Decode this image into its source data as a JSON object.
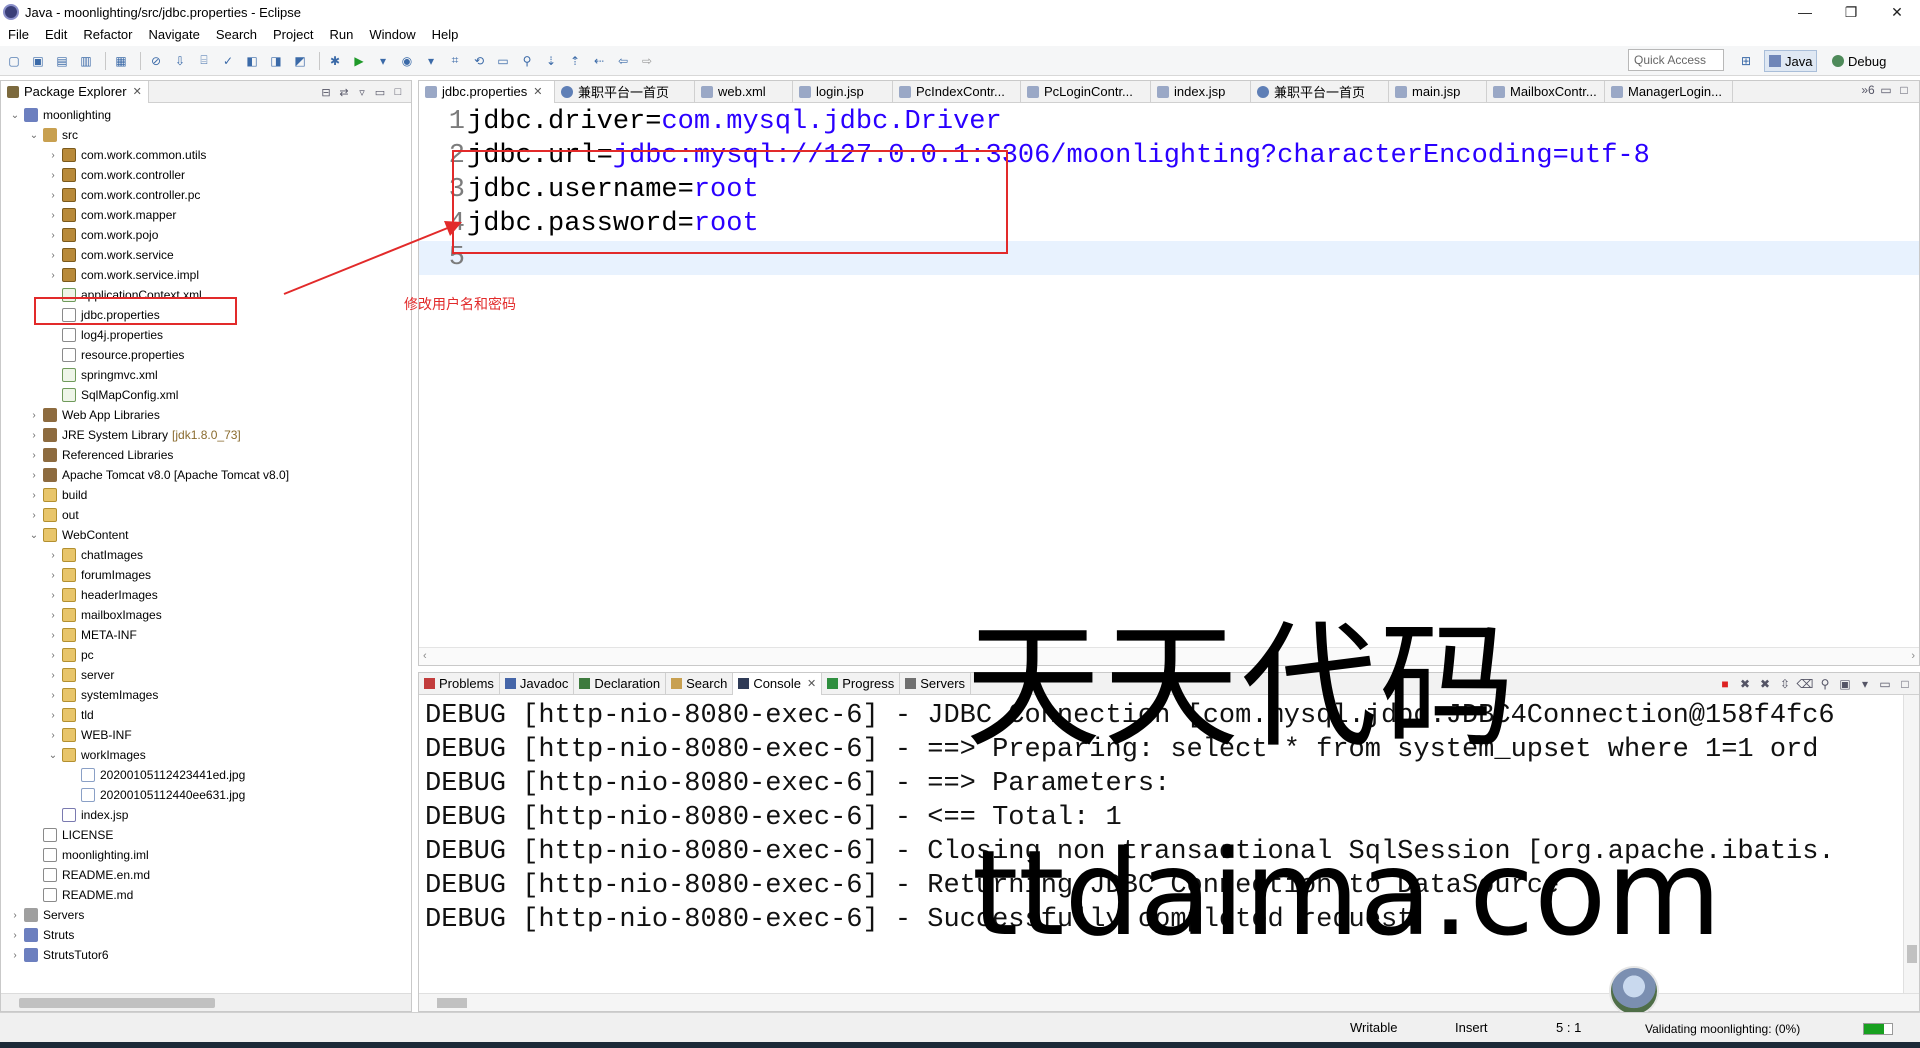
{
  "window": {
    "title": "Java - moonlighting/src/jdbc.properties - Eclipse",
    "controls": [
      "—",
      "❐",
      "✕"
    ]
  },
  "menu": [
    "File",
    "Edit",
    "Refactor",
    "Navigate",
    "Search",
    "Project",
    "Run",
    "Window",
    "Help"
  ],
  "toolbar": {
    "quick_access_placeholder": "Quick Access",
    "perspectives": [
      "Java",
      "Debug"
    ]
  },
  "package_explorer": {
    "tab_label": "Package Explorer",
    "tree": [
      {
        "label": "moonlighting",
        "level": 0,
        "twisty": "open",
        "icon": "project-icon"
      },
      {
        "label": "src",
        "level": 1,
        "twisty": "open",
        "icon": "source-folder-icon"
      },
      {
        "label": "com.work.common.utils",
        "level": 2,
        "twisty": "closed",
        "icon": "package-icon"
      },
      {
        "label": "com.work.controller",
        "level": 2,
        "twisty": "closed",
        "icon": "package-icon"
      },
      {
        "label": "com.work.controller.pc",
        "level": 2,
        "twisty": "closed",
        "icon": "package-icon"
      },
      {
        "label": "com.work.mapper",
        "level": 2,
        "twisty": "closed",
        "icon": "package-icon"
      },
      {
        "label": "com.work.pojo",
        "level": 2,
        "twisty": "closed",
        "icon": "package-icon"
      },
      {
        "label": "com.work.service",
        "level": 2,
        "twisty": "closed",
        "icon": "package-icon"
      },
      {
        "label": "com.work.service.impl",
        "level": 2,
        "twisty": "closed",
        "icon": "package-icon"
      },
      {
        "label": "applicationContext.xml",
        "level": 2,
        "twisty": "",
        "icon": "xml-file-icon"
      },
      {
        "label": "jdbc.properties",
        "level": 2,
        "twisty": "",
        "icon": "properties-file-icon"
      },
      {
        "label": "log4j.properties",
        "level": 2,
        "twisty": "",
        "icon": "properties-file-icon"
      },
      {
        "label": "resource.properties",
        "level": 2,
        "twisty": "",
        "icon": "properties-file-icon"
      },
      {
        "label": "springmvc.xml",
        "level": 2,
        "twisty": "",
        "icon": "xml-file-icon"
      },
      {
        "label": "SqlMapConfig.xml",
        "level": 2,
        "twisty": "",
        "icon": "xml-file-icon"
      },
      {
        "label": "Web App Libraries",
        "level": 1,
        "twisty": "closed",
        "icon": "library-icon"
      },
      {
        "label": "JRE System Library",
        "level": 1,
        "twisty": "closed",
        "icon": "library-icon",
        "suffix": "[jdk1.8.0_73]"
      },
      {
        "label": "Referenced Libraries",
        "level": 1,
        "twisty": "closed",
        "icon": "library-icon"
      },
      {
        "label": "Apache Tomcat v8.0 [Apache Tomcat v8.0]",
        "level": 1,
        "twisty": "closed",
        "icon": "library-icon"
      },
      {
        "label": "build",
        "level": 1,
        "twisty": "closed",
        "icon": "folder-icon"
      },
      {
        "label": "out",
        "level": 1,
        "twisty": "closed",
        "icon": "folder-icon"
      },
      {
        "label": "WebContent",
        "level": 1,
        "twisty": "open",
        "icon": "folder-icon"
      },
      {
        "label": "chatImages",
        "level": 2,
        "twisty": "closed",
        "icon": "folder-icon"
      },
      {
        "label": "forumImages",
        "level": 2,
        "twisty": "closed",
        "icon": "folder-icon"
      },
      {
        "label": "headerImages",
        "level": 2,
        "twisty": "closed",
        "icon": "folder-icon"
      },
      {
        "label": "mailboxImages",
        "level": 2,
        "twisty": "closed",
        "icon": "folder-icon"
      },
      {
        "label": "META-INF",
        "level": 2,
        "twisty": "closed",
        "icon": "folder-icon"
      },
      {
        "label": "pc",
        "level": 2,
        "twisty": "closed",
        "icon": "folder-icon"
      },
      {
        "label": "server",
        "level": 2,
        "twisty": "closed",
        "icon": "folder-icon"
      },
      {
        "label": "systemImages",
        "level": 2,
        "twisty": "closed",
        "icon": "folder-icon"
      },
      {
        "label": "tld",
        "level": 2,
        "twisty": "closed",
        "icon": "folder-icon"
      },
      {
        "label": "WEB-INF",
        "level": 2,
        "twisty": "closed",
        "icon": "folder-icon"
      },
      {
        "label": "workImages",
        "level": 2,
        "twisty": "open",
        "icon": "folder-icon"
      },
      {
        "label": "20200105112423441ed.jpg",
        "level": 3,
        "twisty": "",
        "icon": "image-file-icon"
      },
      {
        "label": "20200105112440ee631.jpg",
        "level": 3,
        "twisty": "",
        "icon": "image-file-icon"
      },
      {
        "label": "index.jsp",
        "level": 2,
        "twisty": "",
        "icon": "jsp-file-icon"
      },
      {
        "label": "LICENSE",
        "level": 1,
        "twisty": "",
        "icon": "file-icon"
      },
      {
        "label": "moonlighting.iml",
        "level": 1,
        "twisty": "",
        "icon": "file-icon"
      },
      {
        "label": "README.en.md",
        "level": 1,
        "twisty": "",
        "icon": "file-icon"
      },
      {
        "label": "README.md",
        "level": 1,
        "twisty": "",
        "icon": "file-icon"
      },
      {
        "label": "Servers",
        "level": 0,
        "twisty": "closed",
        "icon": "server-project-icon"
      },
      {
        "label": "Struts",
        "level": 0,
        "twisty": "closed",
        "icon": "project-icon"
      },
      {
        "label": "StrutsTutor6",
        "level": 0,
        "twisty": "closed",
        "icon": "project-icon"
      }
    ]
  },
  "editor": {
    "tabs": [
      {
        "label": "jdbc.properties",
        "active": true
      },
      {
        "label": "兼职平台一首页",
        "globe": true
      },
      {
        "label": "web.xml"
      },
      {
        "label": "login.jsp"
      },
      {
        "label": "PcIndexContr..."
      },
      {
        "label": "PcLoginContr..."
      },
      {
        "label": "index.jsp"
      },
      {
        "label": "兼职平台一首页",
        "globe": true
      },
      {
        "label": "main.jsp"
      },
      {
        "label": "MailboxContr..."
      },
      {
        "label": "ManagerLogin..."
      }
    ],
    "overflow_count": "»6",
    "lines": [
      {
        "no": "1",
        "key": "jdbc.driver=",
        "value": "com.mysql.jdbc.Driver"
      },
      {
        "no": "2",
        "key": "jdbc.url=",
        "value": "jdbc:mysql://127.0.0.1:3306/moonlighting?characterEncoding=utf-8"
      },
      {
        "no": "3",
        "key": "jdbc.username=",
        "value": "root"
      },
      {
        "no": "4",
        "key": "jdbc.password=",
        "value": "root"
      },
      {
        "no": "5",
        "key": "",
        "value": "",
        "current": true
      }
    ]
  },
  "annotation": {
    "text": "修改用户名和密码",
    "color": "#e22a2a"
  },
  "console": {
    "tabs": [
      {
        "label": "Problems",
        "icon": "problems-icon"
      },
      {
        "label": "Javadoc",
        "icon": "javadoc-icon"
      },
      {
        "label": "Declaration",
        "icon": "declaration-icon"
      },
      {
        "label": "Search",
        "icon": "search-icon"
      },
      {
        "label": "Console",
        "icon": "console-icon",
        "active": true
      },
      {
        "label": "Progress",
        "icon": "progress-icon"
      },
      {
        "label": "Servers",
        "icon": "servers-icon"
      }
    ],
    "lines": [
      "DEBUG [http-nio-8080-exec-6] - JDBC Connection [com.mysql.jdbc.JDBC4Connection@158f4fc6",
      "DEBUG [http-nio-8080-exec-6] - ==>  Preparing: select * from system_upset where 1=1 ord",
      "DEBUG [http-nio-8080-exec-6] - ==> Parameters: ",
      "DEBUG [http-nio-8080-exec-6] - <==      Total: 1",
      "DEBUG [http-nio-8080-exec-6] - Closing non transactional SqlSession [org.apache.ibatis.",
      "DEBUG [http-nio-8080-exec-6] - Returning JDBC Connection to DataSource",
      "DEBUG [http-nio-8080-exec-6] - Successfully completed request"
    ]
  },
  "watermark": {
    "chinese": "天天代码",
    "domain": "ttdaima.com"
  },
  "statusbar": {
    "writable": "Writable",
    "insert_mode": "Insert",
    "cursor_position": "5 : 1",
    "task": "Validating moonlighting: (0%)",
    "task_progress": 0.7
  }
}
